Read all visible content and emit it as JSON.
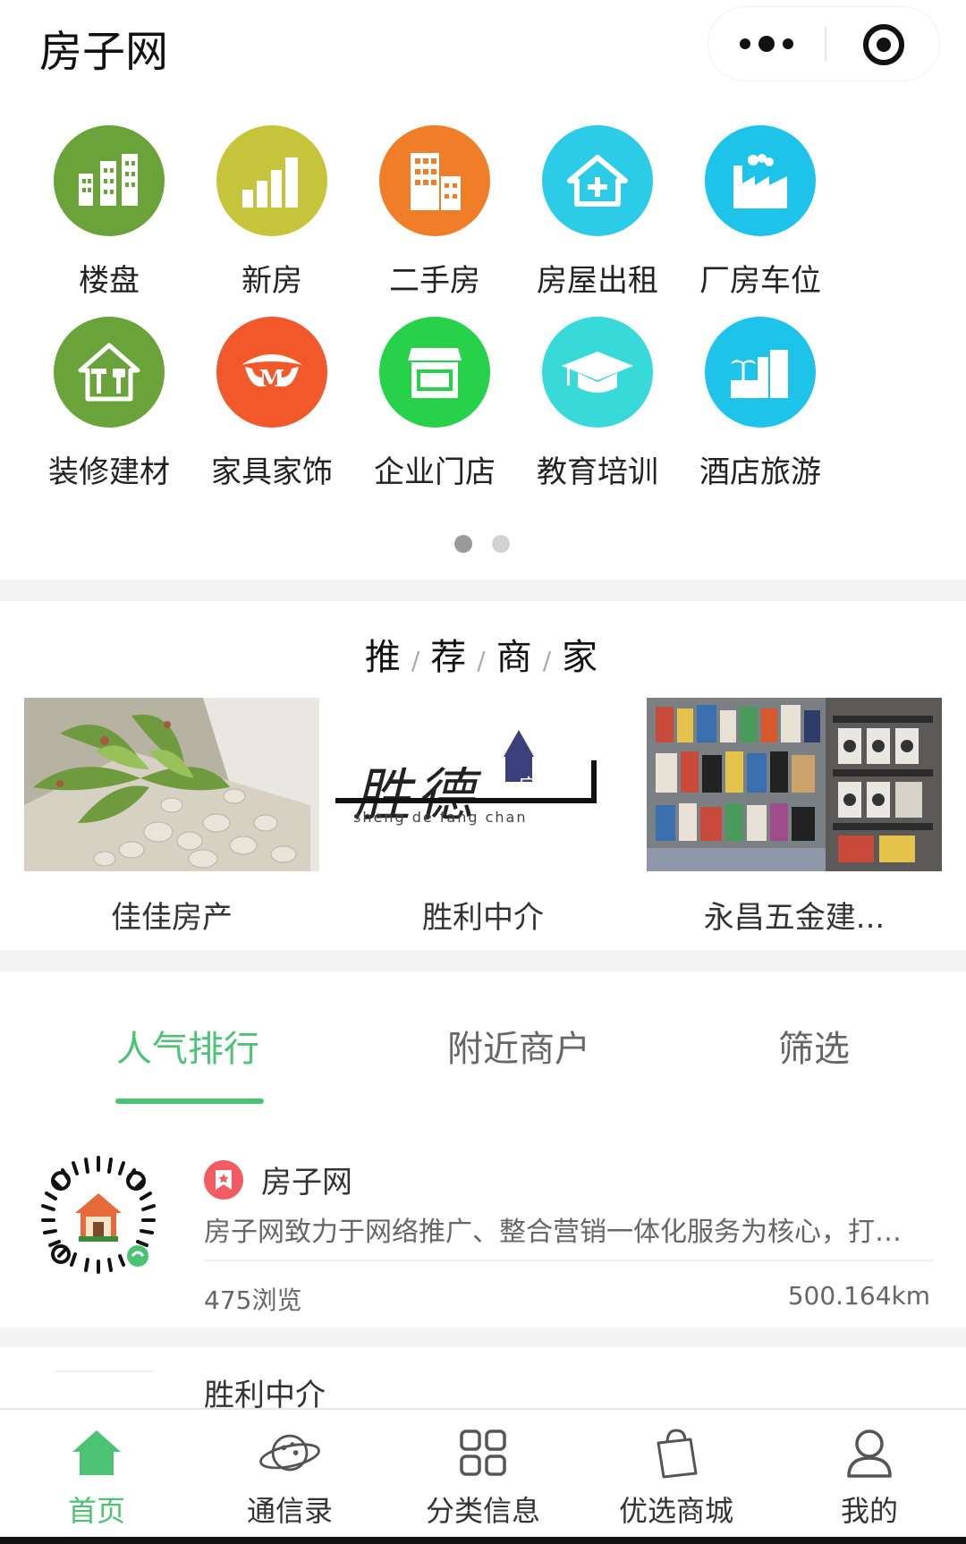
{
  "header": {
    "title": "房子网",
    "more_icon": "more-dots-icon",
    "close_icon": "target-close-icon"
  },
  "categories": [
    {
      "label": "楼盘",
      "icon": "buildings-icon",
      "color": "#6aa33a"
    },
    {
      "label": "新房",
      "icon": "bar-buildings-icon",
      "color": "#c6c43a"
    },
    {
      "label": "二手房",
      "icon": "office-building-icon",
      "color": "#f07d28"
    },
    {
      "label": "房屋出租",
      "icon": "house-plus-icon",
      "color": "#2ccbe8"
    },
    {
      "label": "厂房车位",
      "icon": "factory-icon",
      "color": "#1ec3ea"
    },
    {
      "label": "装修建材",
      "icon": "house-tools-icon",
      "color": "#6aa33a"
    },
    {
      "label": "家具家饰",
      "icon": "furniture-icon",
      "color": "#f1592a"
    },
    {
      "label": "企业门店",
      "icon": "storefront-icon",
      "color": "#28d14a"
    },
    {
      "label": "教育培训",
      "icon": "graduation-cap-icon",
      "color": "#38d9d9"
    },
    {
      "label": "酒店旅游",
      "icon": "resort-icon",
      "color": "#1ec3ea"
    }
  ],
  "pager": {
    "pages": 2,
    "current": 1
  },
  "recommended": {
    "title_chars": [
      "推",
      "荐",
      "商",
      "家"
    ],
    "merchants": [
      {
        "name": "佳佳房产",
        "image": "succulent-plant-photo"
      },
      {
        "name": "胜利中介",
        "image": "shengde-logo",
        "logo_main": "胜德",
        "logo_side": "房产",
        "logo_sub": "sheng de fang chan"
      },
      {
        "name": "永昌五金建...",
        "image": "hardware-store-photo"
      }
    ]
  },
  "tabs": [
    {
      "label": "人气排行",
      "active": true
    },
    {
      "label": "附近商户",
      "active": false
    },
    {
      "label": "筛选",
      "active": false
    }
  ],
  "shops": [
    {
      "name": "房子网",
      "description": "房子网致力于网络推广、整合营销一体化服务为核心，打…",
      "views": "475浏览",
      "distance": "500.164km"
    },
    {
      "name": "胜利中介"
    }
  ],
  "bottom_nav": [
    {
      "label": "首页",
      "icon": "home-icon",
      "active": true
    },
    {
      "label": "通信录",
      "icon": "planet-icon",
      "active": false
    },
    {
      "label": "分类信息",
      "icon": "grid-squares-icon",
      "active": false
    },
    {
      "label": "优选商城",
      "icon": "shopping-bag-icon",
      "active": false
    },
    {
      "label": "我的",
      "icon": "user-icon",
      "active": false
    }
  ],
  "colors": {
    "accent": "#4cc373",
    "badge": "#f15b61"
  }
}
